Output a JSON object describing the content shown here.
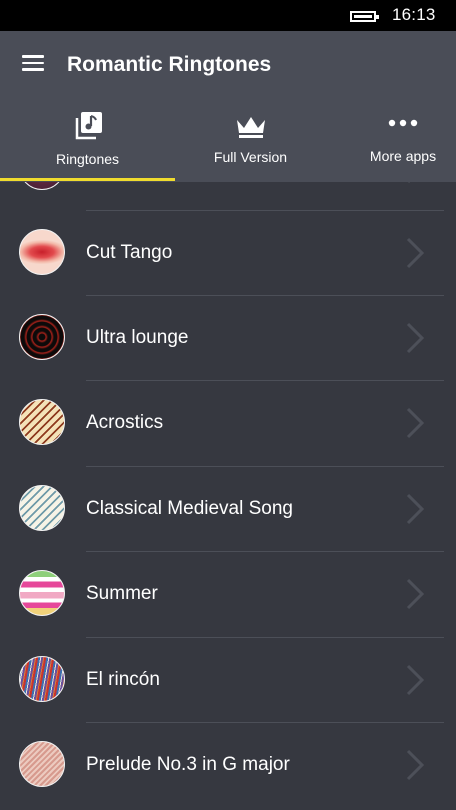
{
  "status_bar": {
    "time": "16:13"
  },
  "header": {
    "title": "Romantic Ringtones"
  },
  "tabs": [
    {
      "label": "Ringtones",
      "icon": "music-library-icon",
      "selected": true
    },
    {
      "label": "Full Version",
      "icon": "crown-icon",
      "selected": false
    },
    {
      "label": "More apps",
      "icon": "more-dots-icon",
      "selected": false
    }
  ],
  "colors": {
    "accent": "#f0dc2e",
    "header_bg": "#4a4d57",
    "list_bg": "#363840"
  },
  "ringtones": [
    {
      "title": "",
      "partially_visible": true
    },
    {
      "title": "Cut Tango"
    },
    {
      "title": "Ultra lounge"
    },
    {
      "title": "Acrostics"
    },
    {
      "title": "Classical Medieval Song"
    },
    {
      "title": "Summer"
    },
    {
      "title": "El rincón"
    },
    {
      "title": "Prelude No.3 in G major"
    }
  ]
}
